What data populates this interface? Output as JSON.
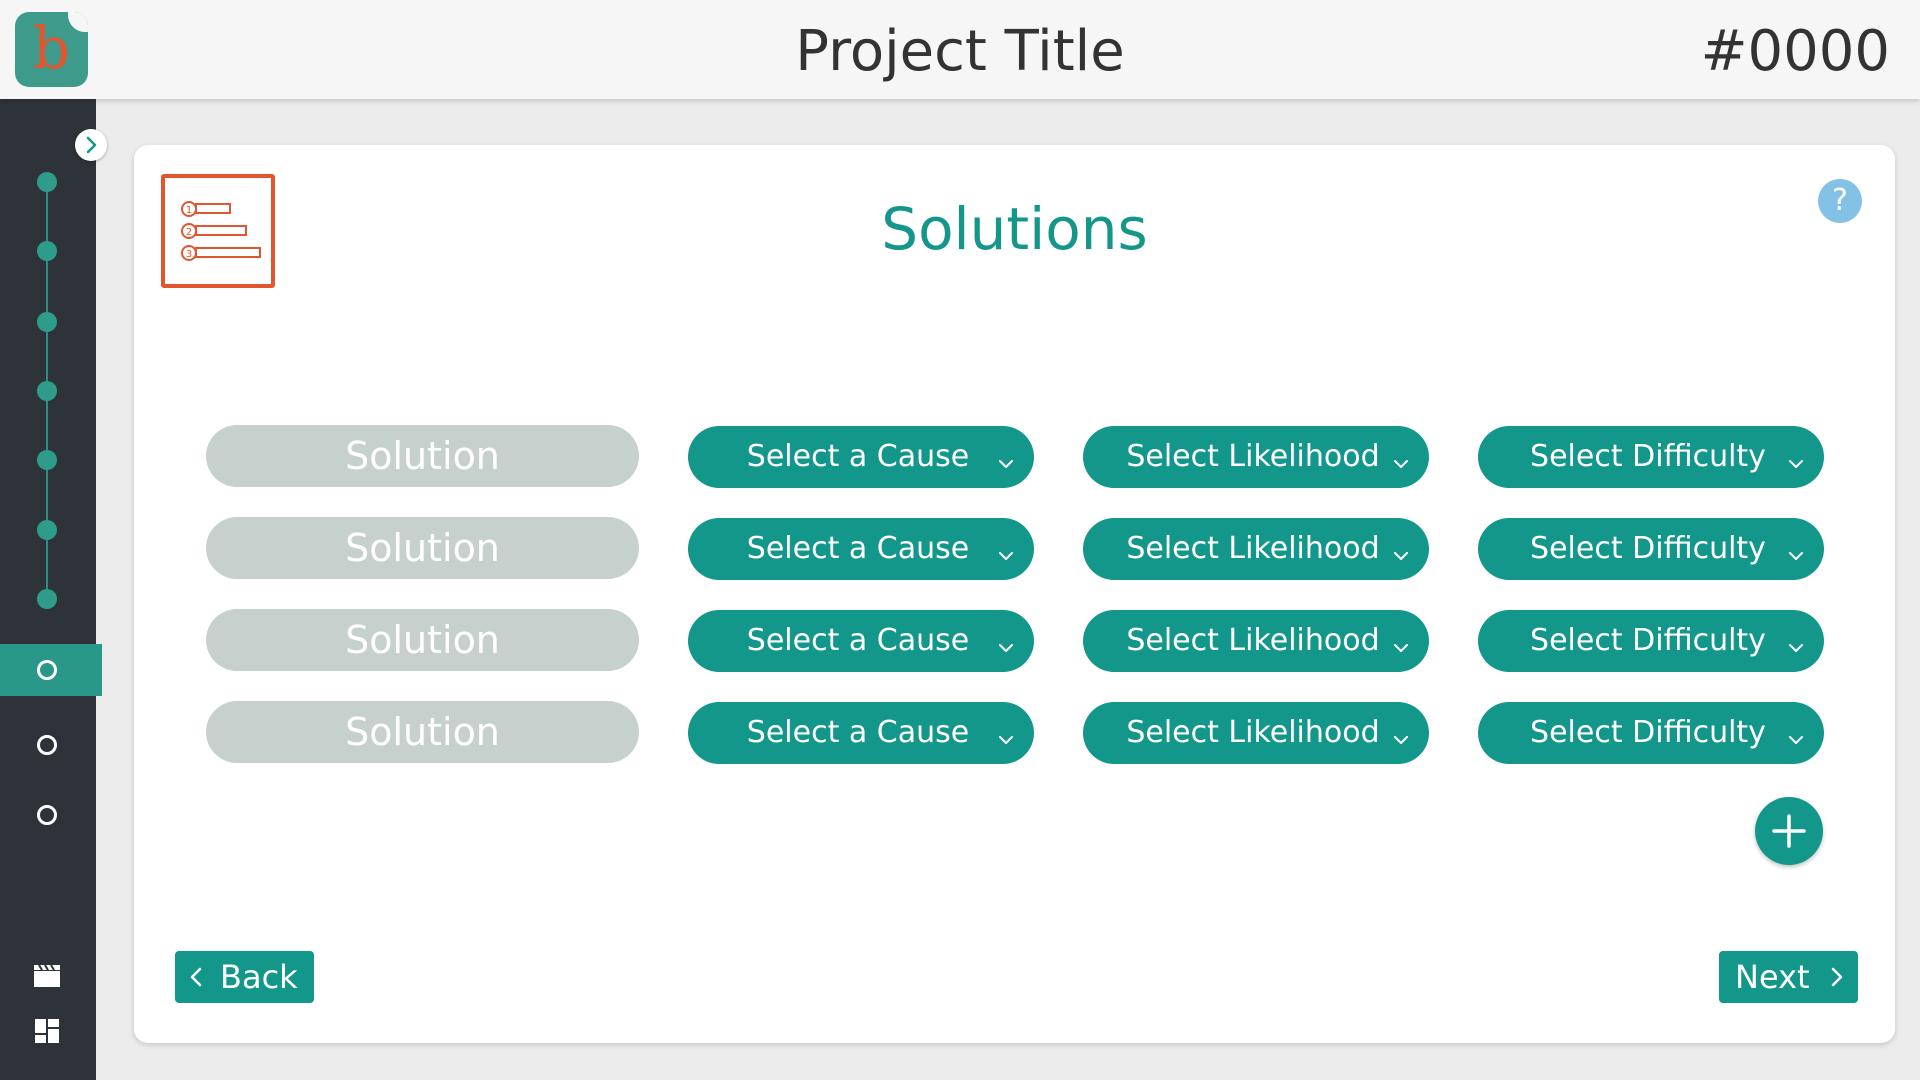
{
  "header": {
    "project_title": "Project Title",
    "project_id": "#0000",
    "logo_letter": "b"
  },
  "sidebar": {
    "steps": [
      {
        "state": "done"
      },
      {
        "state": "done"
      },
      {
        "state": "done"
      },
      {
        "state": "done"
      },
      {
        "state": "done"
      },
      {
        "state": "done"
      },
      {
        "state": "done"
      },
      {
        "state": "current"
      },
      {
        "state": "todo"
      },
      {
        "state": "todo"
      }
    ],
    "bottom_icons": [
      "clapperboard-icon",
      "dashboard-icon"
    ]
  },
  "main": {
    "title": "Solutions",
    "section_icon": "numbered-list-icon",
    "help_label": "?",
    "rows": [
      {
        "solution": "Solution",
        "cause": "Select a Cause",
        "likelihood": "Select Likelihood",
        "difficulty": "Select Difficulty"
      },
      {
        "solution": "Solution",
        "cause": "Select a Cause",
        "likelihood": "Select Likelihood",
        "difficulty": "Select Difficulty"
      },
      {
        "solution": "Solution",
        "cause": "Select a Cause",
        "likelihood": "Select Likelihood",
        "difficulty": "Select Difficulty"
      },
      {
        "solution": "Solution",
        "cause": "Select a Cause",
        "likelihood": "Select Likelihood",
        "difficulty": "Select Difficulty"
      }
    ],
    "back_label": "Back",
    "next_label": "Next"
  },
  "colors": {
    "accent": "#12978a",
    "brand_orange": "#e2562f",
    "sidebar_bg": "#2d3338",
    "solution_field_bg": "#c6d0cc",
    "help_bg": "#84c1e6"
  }
}
